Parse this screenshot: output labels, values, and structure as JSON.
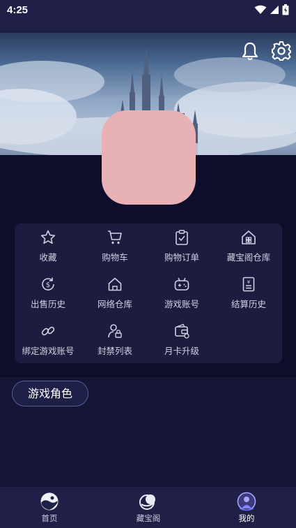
{
  "status": {
    "time": "4:25"
  },
  "header": {
    "bell_icon": "bell-icon",
    "settings_icon": "gear-icon"
  },
  "menu": {
    "items": [
      {
        "label": "收藏",
        "icon": "star-icon"
      },
      {
        "label": "购物车",
        "icon": "cart-icon"
      },
      {
        "label": "购物订单",
        "icon": "clipboard-check-icon"
      },
      {
        "label": "藏宝阁仓库",
        "icon": "warehouse-icon"
      },
      {
        "label": "出售历史",
        "icon": "coin-refresh-icon"
      },
      {
        "label": "网络仓库",
        "icon": "house-icon"
      },
      {
        "label": "游戏账号",
        "icon": "gamepad-icon"
      },
      {
        "label": "结算历史",
        "icon": "receipt-icon"
      },
      {
        "label": "绑定游戏账号",
        "icon": "link-icon"
      },
      {
        "label": "封禁列表",
        "icon": "user-lock-icon"
      },
      {
        "label": "月卡升级",
        "icon": "card-wallet-icon"
      }
    ]
  },
  "role_button": {
    "label": "游戏角色"
  },
  "bottom_nav": {
    "items": [
      {
        "label": "首页",
        "icon": "home-orb-icon",
        "active": false
      },
      {
        "label": "藏宝阁",
        "icon": "treasure-orb-icon",
        "active": false
      },
      {
        "label": "我的",
        "icon": "profile-icon",
        "active": true
      }
    ]
  },
  "colors": {
    "background": "#151636",
    "card": "#1b1c3e",
    "nav": "#202046",
    "avatar": "#e7b1b6"
  }
}
